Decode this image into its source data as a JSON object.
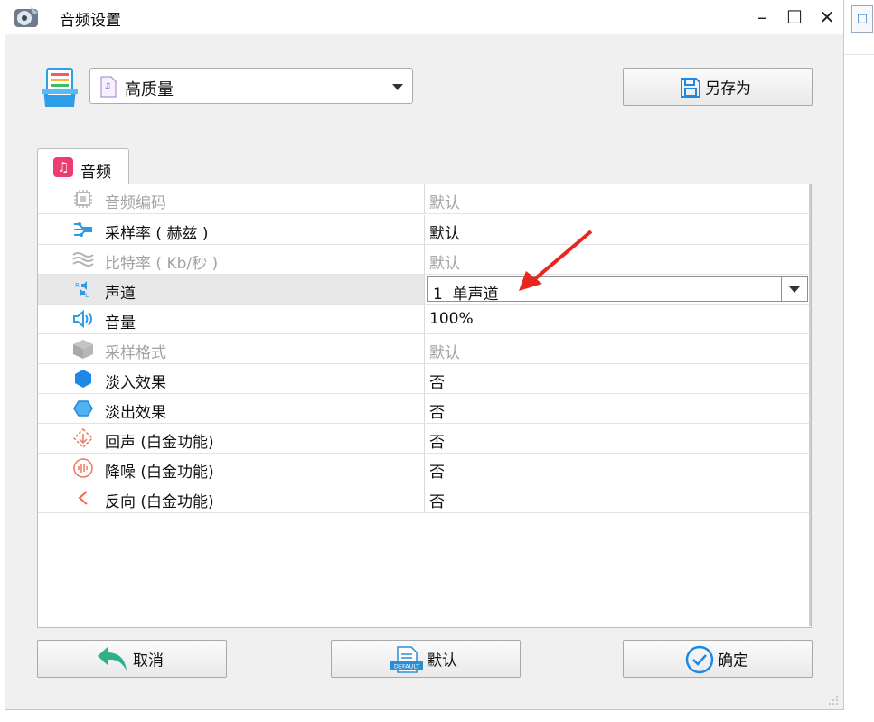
{
  "window": {
    "title": "音频设置",
    "controls": {
      "minimize": "–",
      "maximize": "☐",
      "close": "✕"
    }
  },
  "profile": {
    "selected": "高质量",
    "save_as_label": "另存为"
  },
  "tab": {
    "label": "音频"
  },
  "settings": [
    {
      "name": "音频编码",
      "value": "默认",
      "enabled": false,
      "icon": "chip-icon"
    },
    {
      "name": "采样率 ( 赫兹 )",
      "value": "默认",
      "enabled": true,
      "icon": "sample-rate-icon"
    },
    {
      "name": "比特率 ( Kb/秒 )",
      "value": "默认",
      "enabled": false,
      "icon": "bitrate-wave-icon"
    },
    {
      "name": "声道",
      "value": "1  单声道",
      "enabled": true,
      "selected": true,
      "icon": "channel-icon"
    },
    {
      "name": "音量",
      "value": "100%",
      "enabled": true,
      "icon": "volume-icon"
    },
    {
      "name": "采样格式",
      "value": "默认",
      "enabled": false,
      "icon": "cube-icon"
    },
    {
      "name": "淡入效果",
      "value": "否",
      "enabled": true,
      "icon": "hexagon-filled-icon"
    },
    {
      "name": "淡出效果",
      "value": "否",
      "enabled": true,
      "icon": "hexagon-outline-icon"
    },
    {
      "name": "回声 (白金功能)",
      "value": "否",
      "enabled": true,
      "icon": "echo-icon"
    },
    {
      "name": "降噪 (白金功能)",
      "value": "否",
      "enabled": true,
      "icon": "denoise-icon"
    },
    {
      "name": "反向 (白金功能)",
      "value": "否",
      "enabled": true,
      "icon": "reverse-icon"
    }
  ],
  "buttons": {
    "cancel": "取消",
    "default": "默认",
    "ok": "确定",
    "default_badge": "DEFAULT"
  },
  "colors": {
    "accent_blue": "#1e88e5",
    "tab_icon_pink": "#ef3b72",
    "annotation_red": "#e8261d",
    "disabled_text": "#a3a3a3"
  }
}
